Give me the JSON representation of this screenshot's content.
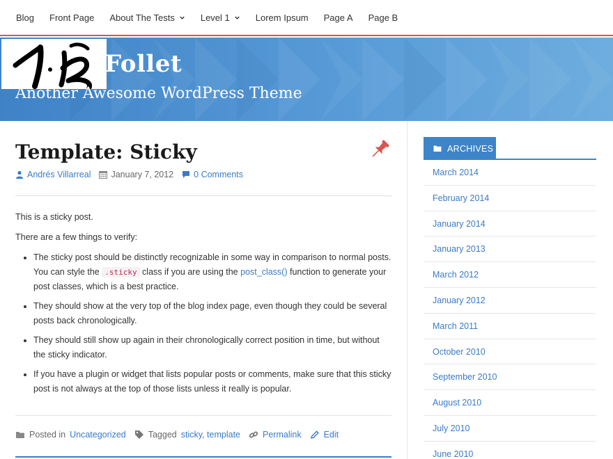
{
  "nav": {
    "items": [
      {
        "label": "Blog"
      },
      {
        "label": "Front Page"
      },
      {
        "label": "About The Tests"
      },
      {
        "label": "Level 1"
      },
      {
        "label": "Lorem Ipsum"
      },
      {
        "label": "Page A"
      },
      {
        "label": "Page B"
      }
    ]
  },
  "header": {
    "title": "Follet",
    "tagline": "Another Awesome WordPress Theme"
  },
  "post": {
    "title": "Template: Sticky",
    "author": "Andrés Villarreal",
    "date": "January 7, 2012",
    "comments": "0 Comments",
    "intro": "This is a sticky post.",
    "verify": "There are a few things to verify:",
    "bullet1_a": "The sticky post should be distinctly recognizable in some way in comparison to normal posts. You can style the ",
    "bullet1_code": ".sticky",
    "bullet1_b": " class if you are using the ",
    "bullet1_link": "post_class()",
    "bullet1_c": " function to generate your post classes, which is a best practice.",
    "bullet2": "They should show at the very top of the blog index page, even though they could be several posts back chronologically.",
    "bullet3": "They should still show up again in their chronologically correct position in time, but without the sticky indicator.",
    "bullet4": "If you have a plugin or widget that lists popular posts or comments, make sure that this sticky post is not always at the top of those lists unless it really is popular.",
    "posted_in_label": "Posted in",
    "category": "Uncategorized",
    "tagged_label": "Tagged",
    "tag1": "sticky",
    "tag_sep": ",",
    "tag2": "template",
    "permalink": "Permalink",
    "edit": "Edit"
  },
  "sidebar": {
    "archives_title": "ARCHIVES",
    "archives": [
      "March 2014",
      "February 2014",
      "January 2014",
      "January 2013",
      "March 2012",
      "January 2012",
      "March 2011",
      "October 2010",
      "September 2010",
      "August 2010",
      "July 2010",
      "June 2010"
    ]
  },
  "colors": {
    "accent": "#3a7bc8",
    "nav_border": "#d9534f",
    "pin": "#d9534f"
  }
}
